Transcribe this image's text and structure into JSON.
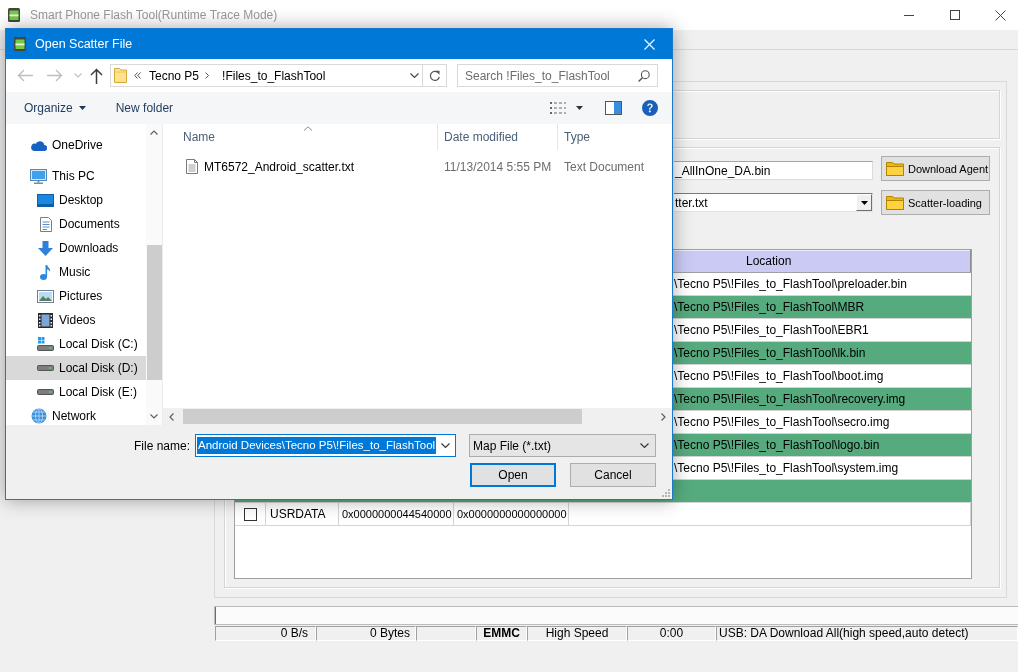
{
  "main_window": {
    "title": "Smart Phone Flash Tool(Runtime Trace Mode)",
    "download_agent": {
      "value": "_AllInOne_DA.bin",
      "button": "Download Agent"
    },
    "scatter": {
      "value": "tter.txt",
      "button": "Scatter-loading"
    },
    "table": {
      "columns": [
        "Location"
      ],
      "rows": [
        {
          "location": "\\Tecno P5\\!Files_to_FlashTool\\preloader.bin"
        },
        {
          "location": "\\Tecno P5\\!Files_to_FlashTool\\MBR"
        },
        {
          "location": "\\Tecno P5\\!Files_to_FlashTool\\EBR1"
        },
        {
          "location": "\\Tecno P5\\!Files_to_FlashTool\\lk.bin"
        },
        {
          "location": "\\Tecno P5\\!Files_to_FlashTool\\boot.img"
        },
        {
          "location": "\\Tecno P5\\!Files_to_FlashTool\\recovery.img"
        },
        {
          "location": "\\Tecno P5\\!Files_to_FlashTool\\secro.img"
        },
        {
          "location": "\\Tecno P5\\!Files_to_FlashTool\\logo.bin"
        },
        {
          "location": "\\Tecno P5\\!Files_to_FlashTool\\system.img"
        },
        {},
        {
          "checked": false,
          "column_2": "USRDATA",
          "column_3": "0x0000000044540000",
          "column_4": "0x0000000000000000"
        }
      ]
    },
    "progress": {
      "level": 0
    },
    "status_bar": {
      "speed": "0 B/s",
      "transferred": "0 Bytes",
      "storage": "EMMC",
      "usb_speed": "High Speed",
      "elapsed": "0:00",
      "connection": "USB: DA Download All(high speed,auto detect)"
    }
  },
  "dialog": {
    "title": "Open Scatter File",
    "nav_buttons": [
      {
        "kind": "back",
        "disabled": true
      },
      {
        "kind": "forward",
        "disabled": true
      },
      {
        "kind": "recent",
        "disabled": true
      },
      {
        "kind": "up",
        "disabled": false
      }
    ],
    "path": [
      "Tecno P5",
      "!Files_to_FlashTool"
    ],
    "search": {
      "placeholder": "Search !Files_to_FlashTool"
    },
    "toolbar": [
      {
        "label": "Organize",
        "kind": "menu"
      },
      {
        "label": "New folder",
        "kind": "button"
      }
    ],
    "navigation": [
      {
        "label": "OneDrive",
        "kind": "cloud",
        "selected": false
      },
      {
        "label": "This PC",
        "kind": "computer",
        "selected": false,
        "children": [
          {
            "label": "Desktop",
            "kind": "desktop",
            "selected": false
          },
          {
            "label": "Documents",
            "kind": "documents",
            "selected": false
          },
          {
            "label": "Downloads",
            "kind": "downloads",
            "selected": false
          },
          {
            "label": "Music",
            "kind": "music",
            "selected": false
          },
          {
            "label": "Pictures",
            "kind": "pictures",
            "selected": false
          },
          {
            "label": "Videos",
            "kind": "videos",
            "selected": false
          },
          {
            "label": "Local Disk (C:)",
            "kind": "system-drive",
            "selected": false
          },
          {
            "label": "Local Disk (D:)",
            "kind": "drive",
            "selected": true
          },
          {
            "label": "Local Disk (E:)",
            "kind": "drive",
            "selected": false
          }
        ]
      },
      {
        "label": "Network",
        "kind": "network",
        "selected": false
      }
    ],
    "columns": [
      {
        "label": "Name",
        "sorted": true
      },
      {
        "label": "Date modified",
        "sorted": false
      },
      {
        "label": "Type",
        "sorted": false
      }
    ],
    "files": [
      {
        "name": "MT6572_Android_scatter.txt",
        "date_modified": "11/13/2014 5:55 PM",
        "type": "Text Document"
      }
    ],
    "file_name": {
      "label": "File name:",
      "value": "Android Devices\\Tecno P5\\!Files_to_FlashTool",
      "selected": true
    },
    "file_type": "Map File (*.txt)",
    "buttons": [
      {
        "label": "Open",
        "default": true
      },
      {
        "label": "Cancel",
        "default": false
      }
    ]
  }
}
